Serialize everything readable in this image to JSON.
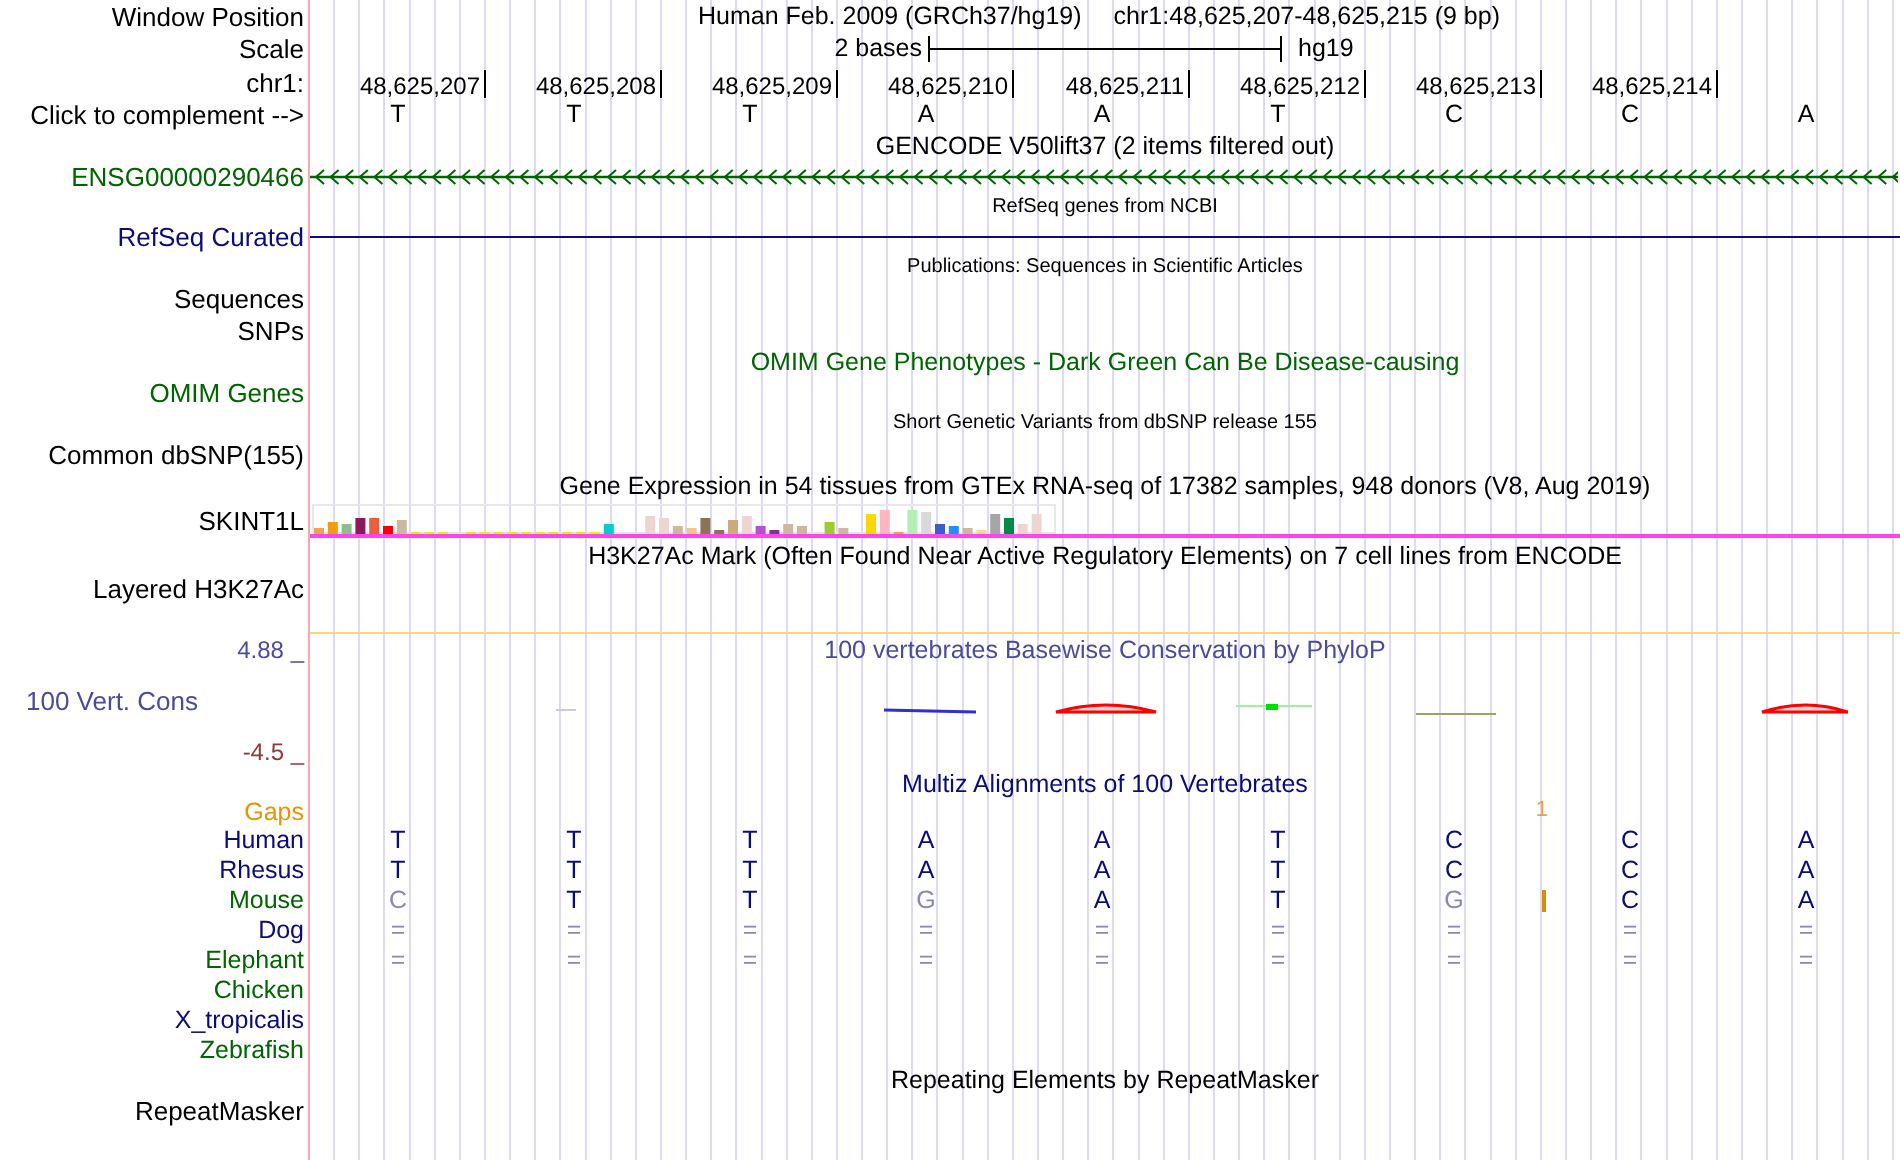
{
  "header": {
    "position_label": "Window Position",
    "assembly": "Human Feb. 2009 (GRCh37/hg19)",
    "position": "chr1:48,625,207-48,625,215 (9 bp)",
    "scale_label": "Scale",
    "scale_text": "2 bases",
    "scale_assembly": "hg19",
    "chrom_label": "chr1:",
    "ticks": [
      "48,625,207",
      "48,625,208",
      "48,625,209",
      "48,625,210",
      "48,625,211",
      "48,625,212",
      "48,625,213",
      "48,625,214"
    ],
    "complement_label": "Click to complement -->",
    "bases": [
      "T",
      "T",
      "T",
      "A",
      "A",
      "T",
      "C",
      "C",
      "A"
    ]
  },
  "tracks": [
    {
      "kind": "gene",
      "title": "GENCODE V50lift37 (2 items filtered out)",
      "labels": [
        "ENSG00000290466"
      ],
      "color": "#006400"
    },
    {
      "kind": "line",
      "title": "RefSeq genes from NCBI",
      "labels": [
        "RefSeq Curated"
      ],
      "color": "#0c0c78"
    },
    {
      "kind": "empty",
      "title": "Publications: Sequences in Scientific Articles",
      "labels": [
        "Sequences",
        "SNPs"
      ],
      "color": "#000000"
    },
    {
      "kind": "empty",
      "title": "OMIM Gene Phenotypes - Dark Green Can Be Disease-causing",
      "labels": [
        "OMIM Genes"
      ],
      "color": "#006400"
    },
    {
      "kind": "empty",
      "title": "Short Genetic Variants from dbSNP release 155",
      "labels": [
        "Common dbSNP(155)"
      ],
      "color": "#000000"
    },
    {
      "kind": "expression",
      "title": "Gene Expression in 54 tissues from GTEx RNA-seq of 17382 samples, 948 donors (V8, Aug 2019)",
      "labels": [
        "SKINT1L"
      ],
      "color": "#000000"
    },
    {
      "kind": "empty",
      "title": "H3K27Ac Mark (Often Found Near Active Regulatory Elements) on 7 cell lines from ENCODE",
      "labels": [
        "Layered H3K27Ac"
      ],
      "color": "#000000"
    },
    {
      "kind": "wiggle",
      "title": "100 vertebrates Basewise Conservation by PhyloP",
      "labels": [
        "100 Vert. Cons"
      ],
      "color": "#4b4b9b",
      "y_max": "4.88 _",
      "y_min": "-4.5 _"
    },
    {
      "kind": "alignment",
      "title": "Multiz Alignments of 100 Vertebrates",
      "color": "#0c0c78",
      "gaps": {
        "label": "Gaps",
        "count": "1"
      },
      "species": [
        {
          "name": "Human",
          "color": "#0c0c78",
          "bases": [
            {
              "base": "T",
              "faded": false,
              "insertion_after": false
            },
            {
              "base": "T",
              "faded": false,
              "insertion_after": false
            },
            {
              "base": "T",
              "faded": false,
              "insertion_after": false
            },
            {
              "base": "A",
              "faded": false,
              "insertion_after": false
            },
            {
              "base": "A",
              "faded": false,
              "insertion_after": false
            },
            {
              "base": "T",
              "faded": false,
              "insertion_after": false
            },
            {
              "base": "C",
              "faded": false,
              "insertion_after": false
            },
            {
              "base": "C",
              "faded": false,
              "insertion_after": false
            },
            {
              "base": "A",
              "faded": false,
              "insertion_after": false
            }
          ]
        },
        {
          "name": "Rhesus",
          "color": "#0c0c78",
          "bases": [
            {
              "base": "T",
              "faded": false,
              "insertion_after": false
            },
            {
              "base": "T",
              "faded": false,
              "insertion_after": false
            },
            {
              "base": "T",
              "faded": false,
              "insertion_after": false
            },
            {
              "base": "A",
              "faded": false,
              "insertion_after": false
            },
            {
              "base": "A",
              "faded": false,
              "insertion_after": false
            },
            {
              "base": "T",
              "faded": false,
              "insertion_after": false
            },
            {
              "base": "C",
              "faded": false,
              "insertion_after": false
            },
            {
              "base": "C",
              "faded": false,
              "insertion_after": false
            },
            {
              "base": "A",
              "faded": false,
              "insertion_after": false
            }
          ]
        },
        {
          "name": "Mouse",
          "color": "#006400",
          "bases": [
            {
              "base": "C",
              "faded": true,
              "insertion_after": false
            },
            {
              "base": "T",
              "faded": false,
              "insertion_after": false
            },
            {
              "base": "T",
              "faded": false,
              "insertion_after": false
            },
            {
              "base": "G",
              "faded": true,
              "insertion_after": false
            },
            {
              "base": "A",
              "faded": false,
              "insertion_after": false
            },
            {
              "base": "T",
              "faded": false,
              "insertion_after": false
            },
            {
              "base": "G",
              "faded": true,
              "insertion_after": true
            },
            {
              "base": "C",
              "faded": false,
              "insertion_after": false
            },
            {
              "base": "A",
              "faded": false,
              "insertion_after": false
            }
          ]
        },
        {
          "name": "Dog",
          "color": "#0c0c78",
          "bases": [
            {
              "base": "=",
              "faded": true,
              "insertion_after": false
            },
            {
              "base": "=",
              "faded": true,
              "insertion_after": false
            },
            {
              "base": "=",
              "faded": true,
              "insertion_after": false
            },
            {
              "base": "=",
              "faded": true,
              "insertion_after": false
            },
            {
              "base": "=",
              "faded": true,
              "insertion_after": false
            },
            {
              "base": "=",
              "faded": true,
              "insertion_after": false
            },
            {
              "base": "=",
              "faded": true,
              "insertion_after": false
            },
            {
              "base": "=",
              "faded": true,
              "insertion_after": false
            },
            {
              "base": "=",
              "faded": true,
              "insertion_after": false
            }
          ]
        },
        {
          "name": "Elephant",
          "color": "#006400",
          "bases": [
            {
              "base": "=",
              "faded": true,
              "insertion_after": false
            },
            {
              "base": "=",
              "faded": true,
              "insertion_after": false
            },
            {
              "base": "=",
              "faded": true,
              "insertion_after": false
            },
            {
              "base": "=",
              "faded": true,
              "insertion_after": false
            },
            {
              "base": "=",
              "faded": true,
              "insertion_after": false
            },
            {
              "base": "=",
              "faded": true,
              "insertion_after": false
            },
            {
              "base": "=",
              "faded": true,
              "insertion_after": false
            },
            {
              "base": "=",
              "faded": true,
              "insertion_after": false
            },
            {
              "base": "=",
              "faded": true,
              "insertion_after": false
            }
          ]
        },
        {
          "name": "Chicken",
          "color": "#006400"
        },
        {
          "name": "X_tropicalis",
          "color": "#0c0c78"
        },
        {
          "name": "Zebrafish",
          "color": "#006400"
        }
      ]
    },
    {
      "kind": "empty",
      "title": "Repeating Elements by RepeatMasker",
      "labels": [
        "RepeatMasker"
      ],
      "color": "#000000"
    }
  ]
}
